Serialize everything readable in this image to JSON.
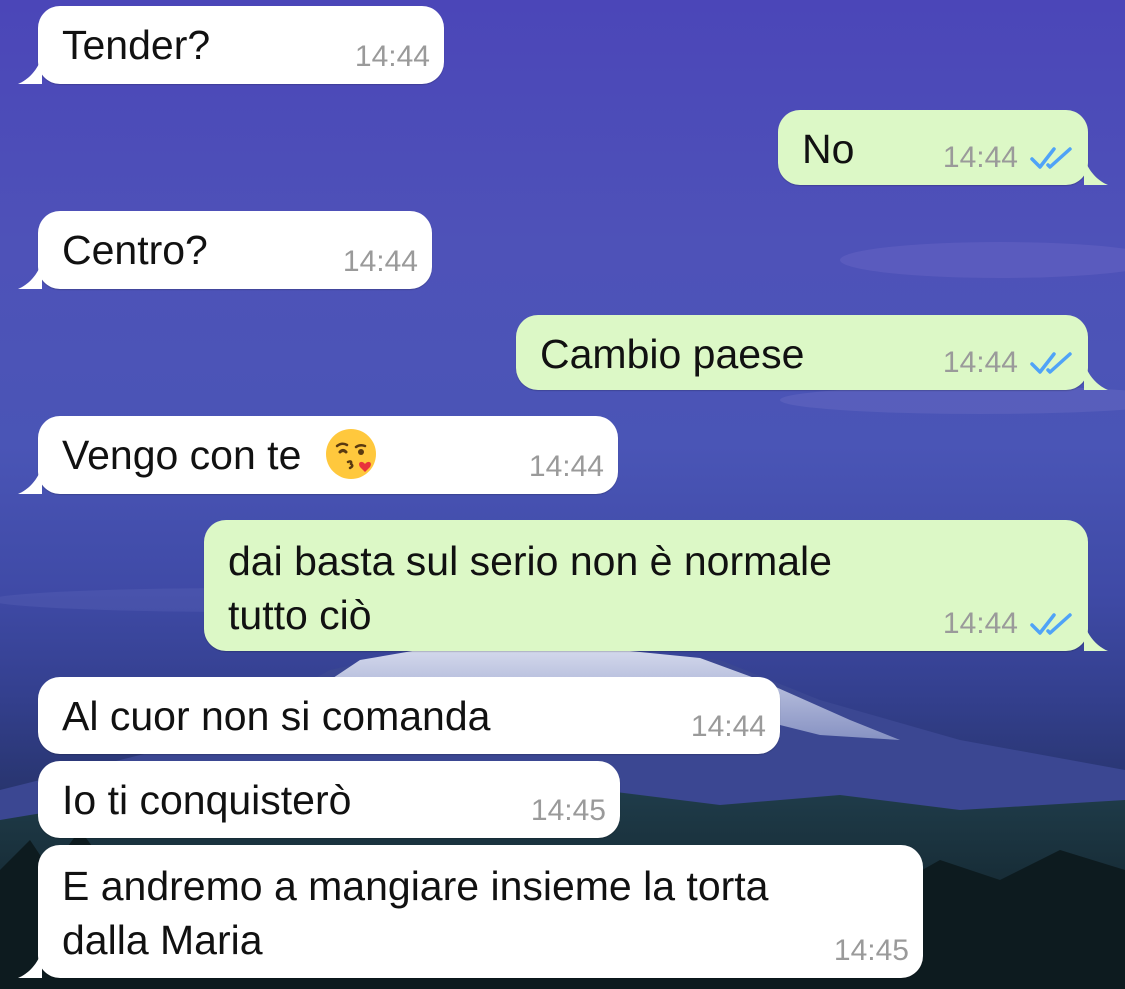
{
  "messages": [
    {
      "text": "Tender?",
      "time": "14:44"
    },
    {
      "text": "No",
      "time": "14:44"
    },
    {
      "text": "Centro?",
      "time": "14:44"
    },
    {
      "text": "Cambio paese",
      "time": "14:44"
    },
    {
      "text": "Vengo con te",
      "emoji": "kissing-face-icon",
      "time": "14:44"
    },
    {
      "line1": "dai basta sul serio non è normale",
      "line2": "tutto ciò",
      "time": "14:44"
    },
    {
      "text": "Al cuor non si comanda",
      "time": "14:44"
    },
    {
      "text": "Io ti conquisterò",
      "time": "14:45"
    },
    {
      "line1": "E andremo a mangiare insieme la torta",
      "line2": "dalla Maria",
      "time": "14:45"
    }
  ],
  "colors": {
    "incoming_bubble": "#ffffff",
    "outgoing_bubble": "#dcf8c6",
    "read_ticks": "#4fa3f7",
    "timestamp": "#9a9a9a"
  },
  "wallpaper": "purple-night-sky-snowy-mountain-forest"
}
